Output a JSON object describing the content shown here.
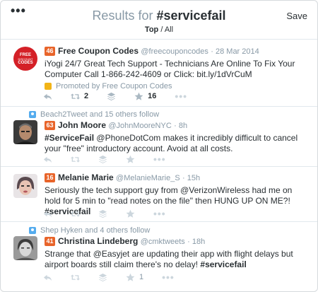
{
  "header": {
    "more_label": "•••",
    "title_prefix": "Results for ",
    "title_query": "#servicefail",
    "save_label": "Save",
    "filter_top": "Top",
    "filter_sep": " / ",
    "filter_all": "All"
  },
  "tweets": [
    {
      "score": "46",
      "name": "Free Coupon Codes",
      "handle": "@freecouponcodes",
      "time": "· 28 Mar 2014",
      "text": "iYogi 24/7 Great Tech Support - Technicians Are Online To Fix Your Computer Call 1-866-242-4609 or Click: bit.ly/1dVrCuM",
      "promo": "Promoted by Free Coupon Codes",
      "avatar_text": [
        "FREE",
        "DISCOUNT",
        "CODES"
      ],
      "retweets": "2",
      "favorites": "16"
    },
    {
      "social": "Beach2Tweet and 15 others follow",
      "score": "63",
      "name": "John Moore",
      "handle": "@JohnMooreNYC",
      "time": "· 8h",
      "hashtag": "#ServiceFail",
      "text": " @PhoneDotCom makes it incredibly difficult to cancel your \"free\" introductory account.  Avoid at all costs."
    },
    {
      "score": "16",
      "name": "Melanie Marie",
      "handle": "@MelanieMarie_S",
      "time": "· 15h",
      "text": "Seriously the tech support guy from @VerizonWireless had me on hold for 5 min to \"read notes on the file\" then HUNG UP ON ME?! ",
      "hashtag": "#servicefail"
    },
    {
      "social": "Shep Hyken and 4 others follow",
      "score": "41",
      "name": "Christina Lindeberg",
      "handle": "@cmktweets",
      "time": "· 18h",
      "text": "Strange that @Easyjet are updating their app with flight delays but airport boards still claim there's no delay! ",
      "hashtag": "#servicefail",
      "favorites": "1"
    }
  ],
  "actions": {
    "more_label": "•••"
  },
  "colors": {
    "score_badge": "#e8642a",
    "accent": "#55acee",
    "muted": "#8899a6"
  }
}
